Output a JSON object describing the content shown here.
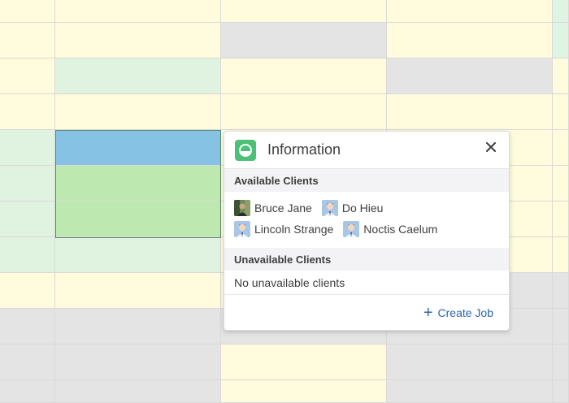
{
  "popover": {
    "title": "Information",
    "icon": "calendar-event-icon",
    "close_icon": "close-icon",
    "available_section": {
      "title": "Available Clients",
      "clients": [
        {
          "name": "Bruce Jane",
          "avatar": "photo-avatar"
        },
        {
          "name": "Do Hieu",
          "avatar": "default-avatar"
        },
        {
          "name": "Lincoln Strange",
          "avatar": "default-avatar"
        },
        {
          "name": "Noctis Caelum",
          "avatar": "default-avatar"
        }
      ]
    },
    "unavailable_section": {
      "title": "Unavailable Clients",
      "empty_text": "No unavailable clients"
    },
    "footer": {
      "create_job_label": "Create Job",
      "create_job_icon": "plus-icon"
    }
  },
  "colors": {
    "yellow_cell": "#fffbdc",
    "gray_cell": "#e4e4e4",
    "light_green_cell": "#dff3e0",
    "green_cell": "#bde9b1",
    "blue_cell": "#86c2e4",
    "accent_link": "#2a65b0",
    "icon_green": "#4bc076"
  }
}
